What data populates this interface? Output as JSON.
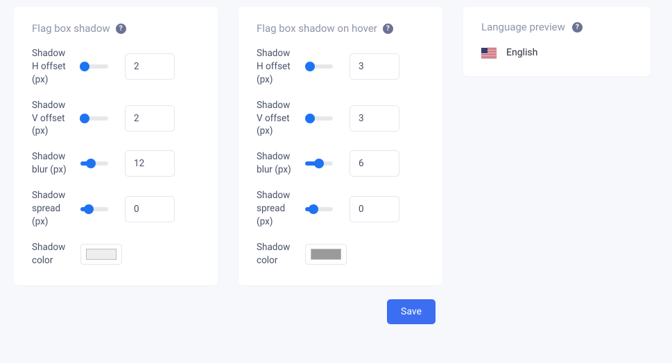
{
  "panel1": {
    "title": "Flag box shadow",
    "h_offset": {
      "label": "Shadow H offset (px)",
      "value": "2",
      "pct": 15
    },
    "v_offset": {
      "label": "Shadow V offset (px)",
      "value": "2",
      "pct": 15
    },
    "blur": {
      "label": "Shadow blur (px)",
      "value": "12",
      "pct": 38
    },
    "spread": {
      "label": "Shadow spread (px)",
      "value": "0",
      "pct": 30
    },
    "color": {
      "label": "Shadow color",
      "swatch": "#eeeeee"
    }
  },
  "panel2": {
    "title": "Flag box shadow on hover",
    "h_offset": {
      "label": "Shadow H offset (px)",
      "value": "3",
      "pct": 18
    },
    "v_offset": {
      "label": "Shadow V offset (px)",
      "value": "3",
      "pct": 18
    },
    "blur": {
      "label": "Shadow blur (px)",
      "value": "6",
      "pct": 50
    },
    "spread": {
      "label": "Shadow spread (px)",
      "value": "0",
      "pct": 30
    },
    "color": {
      "label": "Shadow color",
      "swatch": "#9a9a9a"
    }
  },
  "preview": {
    "title": "Language preview",
    "lang": "English"
  },
  "save_label": "Save"
}
